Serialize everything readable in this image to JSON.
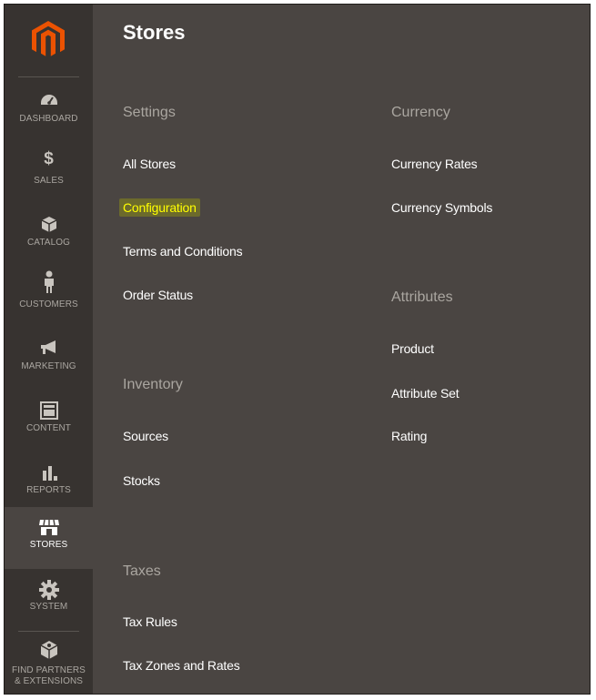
{
  "nav": {
    "items": [
      {
        "label": "DASHBOARD",
        "icon": "dashboard-icon"
      },
      {
        "label": "$",
        "sublabel": "SALES",
        "icon": "dollar-icon"
      },
      {
        "label": "CATALOG",
        "icon": "catalog-cube-icon"
      },
      {
        "label": "CUSTOMERS",
        "icon": "customer-person-icon"
      },
      {
        "label": "MARKETING",
        "icon": "megaphone-icon"
      },
      {
        "label": "CONTENT",
        "icon": "content-layout-icon"
      },
      {
        "label": "REPORTS",
        "icon": "bar-chart-icon"
      },
      {
        "label": "STORES",
        "icon": "storefront-icon",
        "active": true
      },
      {
        "label": "SYSTEM",
        "icon": "gear-icon"
      },
      {
        "label": "FIND PARTNERS & EXTENSIONS",
        "line1": "FIND PARTNERS",
        "line2": "& EXTENSIONS",
        "icon": "extensions-cube-icon"
      }
    ]
  },
  "panel": {
    "title": "Stores",
    "settings": {
      "title": "Settings",
      "links": [
        "All Stores",
        "Configuration",
        "Terms and Conditions",
        "Order Status"
      ]
    },
    "inventory": {
      "title": "Inventory",
      "links": [
        "Sources",
        "Stocks"
      ]
    },
    "taxes": {
      "title": "Taxes",
      "links": [
        "Tax Rules",
        "Tax Zones and Rates"
      ]
    },
    "currency": {
      "title": "Currency",
      "links": [
        "Currency Rates",
        "Currency Symbols"
      ]
    },
    "attributes": {
      "title": "Attributes",
      "links": [
        "Product",
        "Attribute Set",
        "Rating"
      ]
    }
  },
  "colors": {
    "nav_bg": "#373330",
    "panel_bg": "#4a4542",
    "logo_orange": "#eb5202",
    "highlight_text": "#ffff00"
  }
}
